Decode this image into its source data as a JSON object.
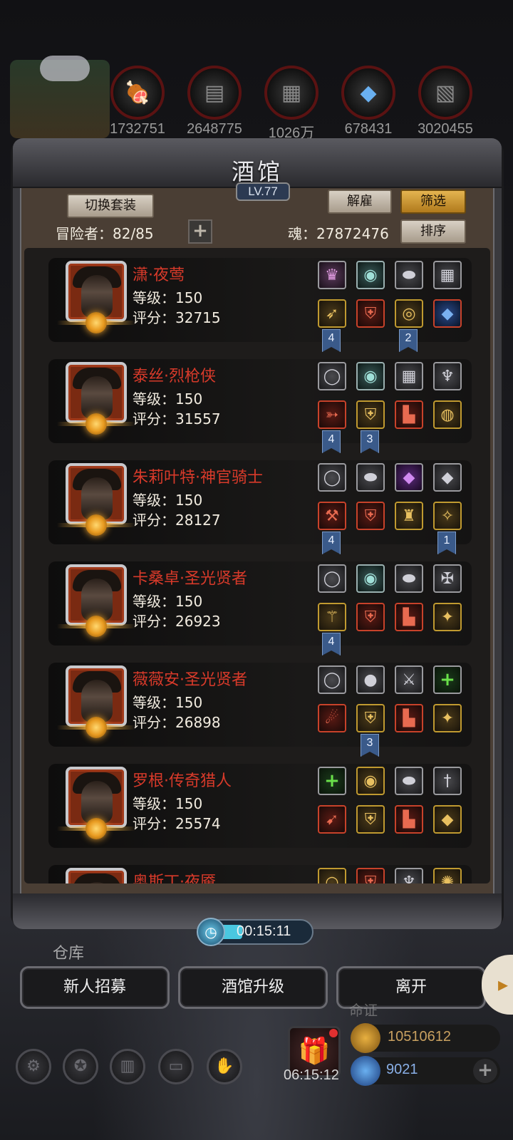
{
  "resources": [
    {
      "icon": "meat-icon",
      "value": "1732751"
    },
    {
      "icon": "wood-icon",
      "value": "2648775"
    },
    {
      "icon": "stone-icon",
      "value": "1026万"
    },
    {
      "icon": "crystal-icon",
      "value": "678431"
    },
    {
      "icon": "iron-icon",
      "value": "3020455"
    }
  ],
  "tavern": {
    "title": "酒馆",
    "level": "LV.77",
    "switch_outfit_label": "切换套装",
    "dismiss_label": "解雇",
    "filter_label": "筛选",
    "sort_label": "排序",
    "adventurers_text": "冒险者：82/85",
    "add_label": "+",
    "soul_text": "魂：27872476"
  },
  "heroes": [
    {
      "name": "潇·夜莺",
      "level": "等级：150",
      "score": "评分：32715",
      "gear_top": [
        {
          "icon": "pink-crown-icon",
          "color": "pink"
        },
        {
          "icon": "teal-amulet-icon",
          "color": "teal"
        },
        {
          "icon": "stone-icon",
          "color": "gray"
        },
        {
          "icon": "chainmail-icon",
          "color": "gray"
        }
      ],
      "gear_bottom": [
        {
          "icon": "spear-icon",
          "color": "gold"
        },
        {
          "icon": "armor-icon",
          "color": "red"
        },
        {
          "icon": "ring-icon",
          "color": "gold"
        },
        {
          "icon": "blue-gem-icon",
          "color": "blue"
        }
      ],
      "tags": [
        {
          "slot": 1,
          "value": "4"
        },
        {
          "slot": 3,
          "value": "2"
        }
      ]
    },
    {
      "name": "泰丝·烈枪侠",
      "level": "等级：150",
      "score": "评分：31557",
      "gear_top": [
        {
          "icon": "silver-ring-icon",
          "color": "gray"
        },
        {
          "icon": "teal-amulet-icon",
          "color": "teal"
        },
        {
          "icon": "chainmail-icon",
          "color": "gray"
        },
        {
          "icon": "lantern-icon",
          "color": "gray"
        }
      ],
      "gear_bottom": [
        {
          "icon": "musket-icon",
          "color": "red"
        },
        {
          "icon": "armor-icon",
          "color": "gold"
        },
        {
          "icon": "boots-icon",
          "color": "red"
        },
        {
          "icon": "dark-ring-icon",
          "color": "gold"
        }
      ],
      "tags": [
        {
          "slot": 1,
          "value": "4"
        },
        {
          "slot": 2,
          "value": "3"
        }
      ]
    },
    {
      "name": "朱莉叶特·神官骑士",
      "level": "等级：150",
      "score": "评分：28127",
      "gear_top": [
        {
          "icon": "silver-ring-icon",
          "color": "gray"
        },
        {
          "icon": "stone-icon",
          "color": "gray"
        },
        {
          "icon": "purple-gem-icon",
          "color": "purple"
        },
        {
          "icon": "purple-gem-icon",
          "color": "gray"
        }
      ],
      "gear_bottom": [
        {
          "icon": "hammer-icon",
          "color": "red"
        },
        {
          "icon": "armor-icon",
          "color": "red"
        },
        {
          "icon": "helmet-icon",
          "color": "gold"
        },
        {
          "icon": "necklace-icon",
          "color": "gold"
        }
      ],
      "tags": [
        {
          "slot": 1,
          "value": "4"
        },
        {
          "slot": 4,
          "value": "1"
        }
      ]
    },
    {
      "name": "卡桑卓·圣光贤者",
      "level": "等级：150",
      "score": "评分：26923",
      "gear_top": [
        {
          "icon": "silver-ring-icon",
          "color": "gray"
        },
        {
          "icon": "teal-amulet-icon",
          "color": "teal"
        },
        {
          "icon": "stone-icon",
          "color": "gray"
        },
        {
          "icon": "rune-icon",
          "color": "gray"
        }
      ],
      "gear_bottom": [
        {
          "icon": "staff-icon",
          "color": "gold"
        },
        {
          "icon": "armor-icon",
          "color": "red"
        },
        {
          "icon": "boots-icon",
          "color": "red"
        },
        {
          "icon": "pendant-icon",
          "color": "gold"
        }
      ],
      "tags": [
        {
          "slot": 1,
          "value": "4"
        }
      ]
    },
    {
      "name": "薇薇安·圣光贤者",
      "level": "等级：150",
      "score": "评分：26898",
      "gear_top": [
        {
          "icon": "silver-ring-icon",
          "color": "gray"
        },
        {
          "icon": "purple-orb-icon",
          "color": "gray"
        },
        {
          "icon": "axe-icon",
          "color": "gray"
        },
        {
          "icon": "add-icon",
          "color": "green"
        }
      ],
      "gear_bottom": [
        {
          "icon": "claw-icon",
          "color": "red"
        },
        {
          "icon": "purple-armor-icon",
          "color": "gold"
        },
        {
          "icon": "boots-icon",
          "color": "red"
        },
        {
          "icon": "pendant-icon",
          "color": "gold"
        }
      ],
      "tags": [
        {
          "slot": 2,
          "value": "3"
        }
      ]
    },
    {
      "name": "罗根·传奇猎人",
      "level": "等级：150",
      "score": "评分：25574",
      "gear_top": [
        {
          "icon": "add-icon",
          "color": "green"
        },
        {
          "icon": "gold-amulet-icon",
          "color": "gold"
        },
        {
          "icon": "stone-icon",
          "color": "gray"
        },
        {
          "icon": "dagger-icon",
          "color": "gray"
        }
      ],
      "gear_bottom": [
        {
          "icon": "crossbow-icon",
          "color": "red"
        },
        {
          "icon": "armor-icon",
          "color": "gold"
        },
        {
          "icon": "boots-icon",
          "color": "red"
        },
        {
          "icon": "purple-gem-icon",
          "color": "gold"
        }
      ],
      "tags": []
    },
    {
      "name": "奥斯丁·夜魇",
      "level": "",
      "score": "",
      "gear_top": [
        {
          "icon": "bracelet-icon",
          "color": "gold"
        },
        {
          "icon": "armor-icon",
          "color": "red"
        },
        {
          "icon": "lantern-icon",
          "color": "gray"
        },
        {
          "icon": "gold-orb-icon",
          "color": "gold"
        }
      ],
      "gear_bottom": [],
      "tags": []
    }
  ],
  "timer": {
    "value": "00:15:11"
  },
  "storage_label": "仓库",
  "actions": {
    "recruit_label": "新人招募",
    "upgrade_label": "酒馆升级",
    "leave_label": "离开"
  },
  "hud": {
    "gift_timer": "06:15:12",
    "gold": "10510612",
    "gems": "9021",
    "partial_label": "命证"
  }
}
